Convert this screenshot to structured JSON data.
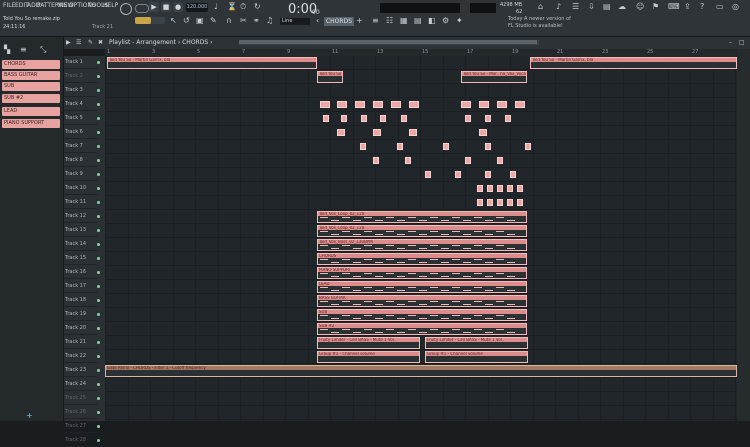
{
  "menu": {
    "file": "FILE",
    "edit": "EDIT",
    "add": "ADD",
    "patterns": "PATTERNS",
    "view": "VIEW",
    "options": "OPTIONS",
    "tools": "TOOLS",
    "help": "HELP"
  },
  "project": {
    "name": "Told You So remake.zip",
    "time": "24:11:16",
    "track_hint": "Track 21"
  },
  "transport": {
    "tempo": "120.000",
    "time_display": "0:00",
    "time_sub": "00",
    "snap": "Line",
    "pattern": "CHORDS"
  },
  "cpu": {
    "mem": "4298 MB",
    "voices": "62"
  },
  "news": {
    "line1": "Today  A newer version of",
    "line2": "FL Studio is available!"
  },
  "browser": {
    "items": [
      "CHORDS",
      "BASS GUITAR",
      "SUB",
      "SUB #2",
      "LEAD",
      "PIANO SUPPORT"
    ]
  },
  "playlist": {
    "title": "Playlist - Arrangement › CHORDS ›",
    "ruler": [
      "1",
      "3",
      "5",
      "7",
      "9",
      "11",
      "13",
      "15",
      "17",
      "19",
      "21",
      "23",
      "25",
      "27"
    ],
    "tracks": [
      "Track 1",
      "Track 2",
      "Track 3",
      "Track 4",
      "Track 5",
      "Track 6",
      "Track 7",
      "Track 8",
      "Track 9",
      "Track 10",
      "Track 11",
      "Track 12",
      "Track 13",
      "Track 14",
      "Track 15",
      "Track 16",
      "Track 17",
      "Track 18",
      "Track 19",
      "Track 20",
      "Track 21",
      "Track 22",
      "Track 23",
      "Track 24",
      "Track 25",
      "Track 26",
      "Track 27",
      "Track 28"
    ],
    "clips": [
      {
        "track": 0,
        "label": "Told You So - Martin Garrix, bla"
      },
      {
        "track": 0,
        "label": "Told You So - Martin Garrix, bla"
      },
      {
        "track": 1,
        "label": "Told You So Ayo..."
      },
      {
        "track": 1,
        "label": "Told You So - Mar...ha_Vox_Vocals"
      },
      {
        "track": 11,
        "label": "Told_Vox_Loop_02_120"
      },
      {
        "track": 12,
        "label": "Told_Vox_Loop_02_120"
      },
      {
        "track": 13,
        "label": "Told_Vox_Bass_02_120BPM"
      },
      {
        "track": 14,
        "label": "CHORDS"
      },
      {
        "track": 15,
        "label": "PIANO SUPPORT"
      },
      {
        "track": 16,
        "label": "LEAD"
      },
      {
        "track": 17,
        "label": "BASS GUITAR"
      },
      {
        "track": 18,
        "label": "SUB"
      },
      {
        "track": 19,
        "label": "SUB #2"
      },
      {
        "track": 20,
        "label": "Fruity Limiter - Ceil BASS - Mute 1 Vol.."
      },
      {
        "track": 20,
        "label": "Fruity Limiter - Ceil BASS - Mute 1 Vol.."
      },
      {
        "track": 21,
        "label": "Group #1 - Channel volume"
      },
      {
        "track": 21,
        "label": "Group #1 - Channel volume"
      },
      {
        "track": 22,
        "label": "Gate Patrol - CHORDS - Filter 1 - Cutoff frequency"
      }
    ]
  }
}
